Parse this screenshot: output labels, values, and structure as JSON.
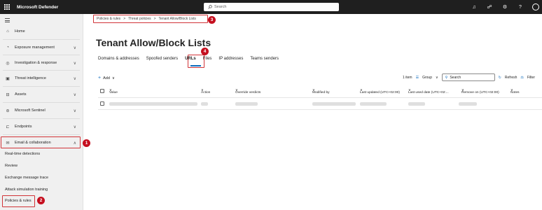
{
  "app": {
    "title": "Microsoft Defender"
  },
  "search": {
    "placeholder": "Search"
  },
  "sidebar": {
    "items": [
      {
        "label": "Home",
        "icon": "home-icon"
      },
      {
        "label": "Exposure management",
        "icon": "shield-icon",
        "chevron": "∨"
      },
      {
        "label": "Investigation & response",
        "icon": "investigation-icon",
        "chevron": "∨"
      },
      {
        "label": "Threat intelligence",
        "icon": "threat-intelligence-icon",
        "chevron": "∨"
      },
      {
        "label": "Assets",
        "icon": "assets-icon",
        "chevron": "∨"
      },
      {
        "label": "Microsoft Sentinel",
        "icon": "sentinel-icon",
        "chevron": "∨"
      },
      {
        "label": "Endpoints",
        "icon": "endpoints-icon",
        "chevron": "∨"
      },
      {
        "label": "Email & collaboration",
        "icon": "mail-icon",
        "chevron": "∧"
      }
    ],
    "sub_items": [
      "Real-time detections",
      "Review",
      "Exchange message trace",
      "Attack simulation training",
      "Policies & rules"
    ]
  },
  "breadcrumb": {
    "items": [
      "Policies & rules",
      "Threat policies",
      "Tenant Allow/Block Lists"
    ],
    "separator": ">"
  },
  "page": {
    "title": "Tenant Allow/Block Lists"
  },
  "tabs": [
    "Domains & addresses",
    "Spoofed senders",
    "URLs",
    "Files",
    "IP addresses",
    "Teams senders"
  ],
  "toolbar": {
    "add_label": "Add",
    "item_count": "1 item",
    "group_label": "Group",
    "search_placeholder": "Search",
    "refresh_label": "Refresh",
    "filter_label": "Filter"
  },
  "table": {
    "columns": [
      "Value",
      "Action",
      "Override verdicts",
      "Modified by",
      "Last updated (UTC+02:00)",
      "Last used date (UTC+02:...",
      "Remove on (UTC+02:00)",
      "Notes"
    ]
  },
  "badges": [
    "1",
    "2",
    "3",
    "4"
  ],
  "colors": {
    "highlight": "#d13438",
    "badge": "#c50f1f",
    "accent": "#0f6cbd"
  }
}
